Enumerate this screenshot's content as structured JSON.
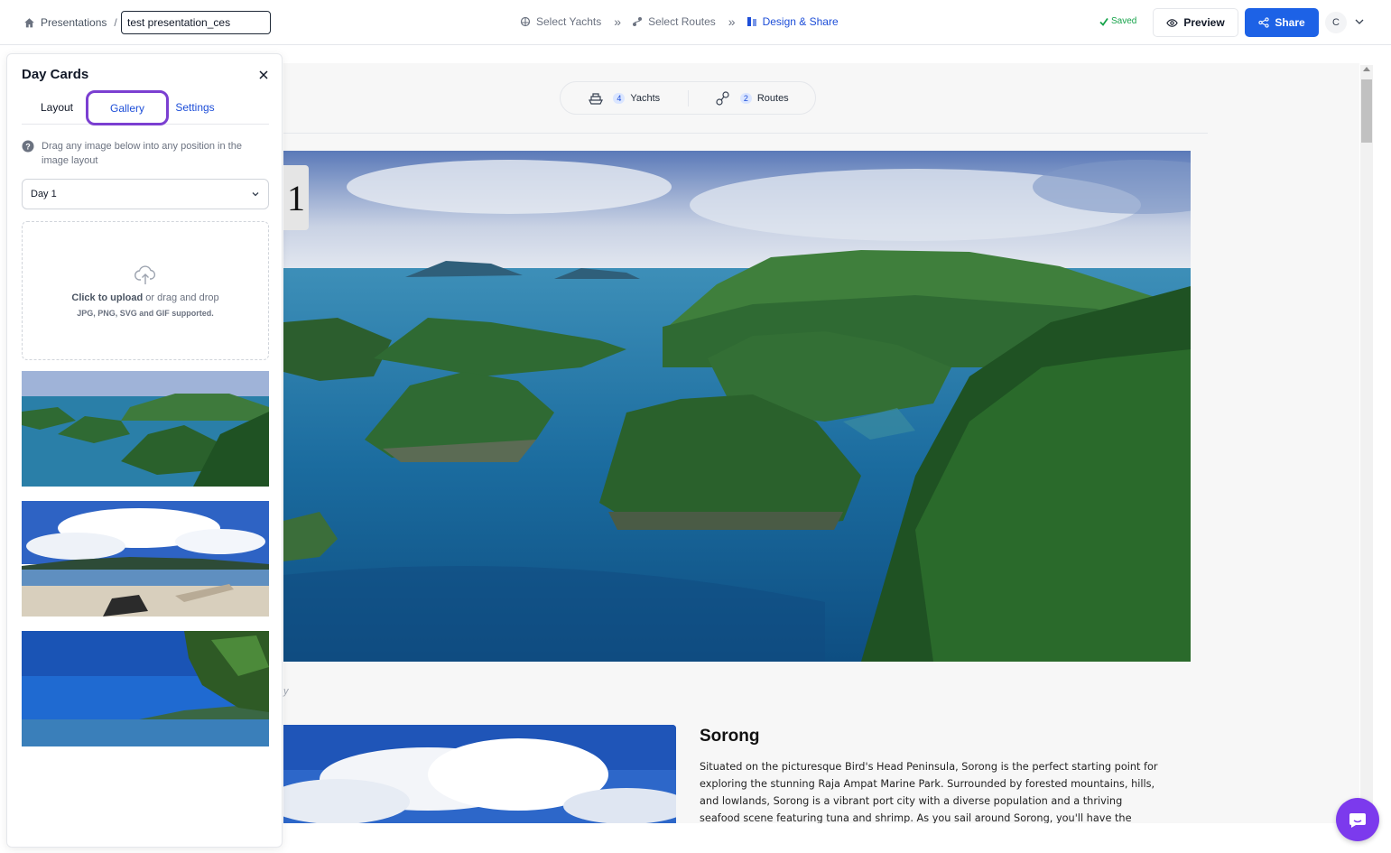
{
  "header": {
    "breadcrumb_root": "Presentations",
    "breadcrumb_sep": "/",
    "title_value": "test presentation_ces",
    "steps": [
      {
        "label": "Select Yachts",
        "icon": "yacht-icon"
      },
      {
        "label": "Select Routes",
        "icon": "route-icon"
      },
      {
        "label": "Design & Share",
        "icon": "design-icon"
      }
    ],
    "saved_label": "Saved",
    "preview_label": "Preview",
    "share_label": "Share",
    "avatar_initial": "C"
  },
  "canvas": {
    "stats": [
      {
        "count": "4",
        "label": "Yachts"
      },
      {
        "count": "2",
        "label": "Routes"
      }
    ],
    "day_number": "1",
    "faint_caption": "y",
    "place_title": "Sorong",
    "place_description": "Situated on the picturesque Bird's Head Peninsula, Sorong is the perfect starting point for exploring the stunning Raja Ampat Marine Park. Surrounded by forested mountains, hills, and lowlands, Sorong is a vibrant port city with a diverse population and a thriving seafood scene featuring tuna and shrimp. As you sail around Sorong, you'll have the"
  },
  "panel": {
    "title": "Day Cards",
    "tabs": [
      "Layout",
      "Gallery",
      "Settings"
    ],
    "active_tab": "Gallery",
    "hint": "Drag any image below into any position in the image layout",
    "day_select": "Day 1",
    "upload_strong": "Click to upload",
    "upload_rest": "or drag and drop",
    "upload_formats": "JPG, PNG, SVG and GIF supported.",
    "gallery_images": [
      "island-lagoon-image",
      "beach-driftwood-image",
      "sea-coast-tree-image"
    ]
  },
  "colors": {
    "accent": "#1d62e6",
    "active_tab_outline": "#7b3fd1",
    "saved": "#16a34a",
    "chat_fab": "#7c3aed"
  }
}
